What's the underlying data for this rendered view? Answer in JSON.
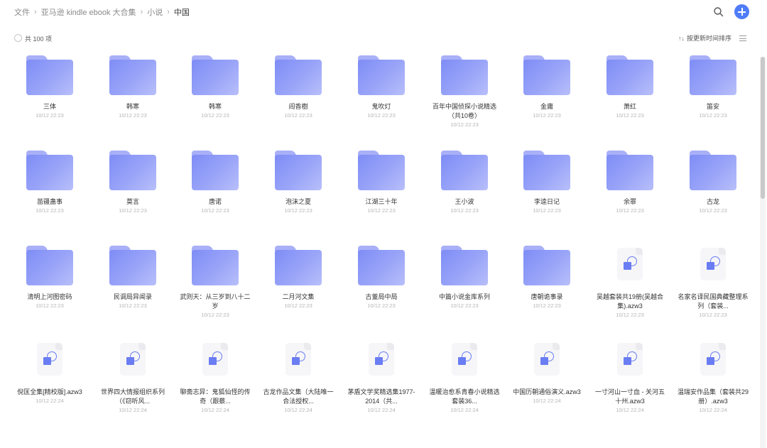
{
  "breadcrumb": [
    "文件",
    "亚马逊 kindle ebook 大合集",
    "小说",
    "中国"
  ],
  "toolbar": {
    "count": "共 100 项",
    "sort_label": "按更新时间排序",
    "sort_icon": "↑↓"
  },
  "icons": {
    "search": "search-icon",
    "add": "plus-icon",
    "list_view": "list-view-icon",
    "folder": "folder-icon",
    "document": "azw3-file-icon"
  },
  "colors": {
    "accent": "#4f7cf7",
    "folder": "#8c98f7"
  },
  "items": [
    {
      "type": "folder",
      "name": "三体",
      "date": "10/12 22:23"
    },
    {
      "type": "folder",
      "name": "韩寒",
      "date": "10/12 22:23"
    },
    {
      "type": "folder",
      "name": "韩寒",
      "date": "10/12 22:23"
    },
    {
      "type": "folder",
      "name": "阎香樹",
      "date": "10/12 22:23"
    },
    {
      "type": "folder",
      "name": "鬼吹灯",
      "date": "10/12 22:23"
    },
    {
      "type": "folder",
      "name": "百年中国侦探小说精选（共10卷）",
      "date": "10/12 22:23"
    },
    {
      "type": "folder",
      "name": "金庸",
      "date": "10/12 22:23"
    },
    {
      "type": "folder",
      "name": "萧红",
      "date": "10/12 22:23"
    },
    {
      "type": "folder",
      "name": "笛安",
      "date": "10/12 22:23"
    },
    {
      "type": "folder",
      "name": "苗疆蛊事",
      "date": "10/12 22:23"
    },
    {
      "type": "folder",
      "name": "莫言",
      "date": "10/12 22:23"
    },
    {
      "type": "folder",
      "name": "唐诺",
      "date": "10/12 22:23"
    },
    {
      "type": "folder",
      "name": "泡沫之夏",
      "date": "10/12 22:23"
    },
    {
      "type": "folder",
      "name": "江湖三十年",
      "date": "10/12 22:23"
    },
    {
      "type": "folder",
      "name": "王小波",
      "date": "10/12 22:23"
    },
    {
      "type": "folder",
      "name": "李逵日记",
      "date": "10/12 22:23"
    },
    {
      "type": "folder",
      "name": "余罪",
      "date": "10/12 22:23"
    },
    {
      "type": "folder",
      "name": "古龙",
      "date": "10/12 22:23"
    },
    {
      "type": "folder",
      "name": "清明上河图密码",
      "date": "10/12 22:23"
    },
    {
      "type": "folder",
      "name": "民调局异闻录",
      "date": "10/12 22:23"
    },
    {
      "type": "folder",
      "name": "武则天：从三岁到八十二岁",
      "date": "10/12 22:23"
    },
    {
      "type": "folder",
      "name": "二月河文集",
      "date": "10/12 22:23"
    },
    {
      "type": "folder",
      "name": "古董局中局",
      "date": "10/12 22:23"
    },
    {
      "type": "folder",
      "name": "中篇小说金库系列",
      "date": "10/12 22:23"
    },
    {
      "type": "folder",
      "name": "唐朝诡事录",
      "date": "10/12 22:23"
    },
    {
      "type": "file",
      "name": "吴越套装共19册(吴越合集).azw3",
      "date": "10/12 22:23"
    },
    {
      "type": "file",
      "name": "名家名译民国典藏整理系列（套装...",
      "date": "10/12 22:23"
    },
    {
      "type": "file",
      "name": "倪匡全集[精校版].azw3",
      "date": "10/12 22:24"
    },
    {
      "type": "file",
      "name": "世界四大情报组织系列（《窃听风...",
      "date": "10/12 22:24"
    },
    {
      "type": "file",
      "name": "聊斋志异：鬼狐仙怪的传奇（跟蔡...",
      "date": "10/12 22:24"
    },
    {
      "type": "file",
      "name": "古龙作品文集（大陆唯一合法授权...",
      "date": "10/12 22:24"
    },
    {
      "type": "file",
      "name": "茅盾文学奖精选集1977-2014（共...",
      "date": "10/12 22:24"
    },
    {
      "type": "file",
      "name": "温暖治愈系青春小说精选套装36...",
      "date": "10/12 22:24"
    },
    {
      "type": "file",
      "name": "中国历朝通俗演义.azw3",
      "date": "10/12 22:24"
    },
    {
      "type": "file",
      "name": "一寸河山一寸血 - 关河五十州.azw3",
      "date": "10/12 22:24"
    },
    {
      "type": "file",
      "name": "温瑞安作品集（套装共29册）.azw3",
      "date": "10/12 22:24"
    }
  ]
}
